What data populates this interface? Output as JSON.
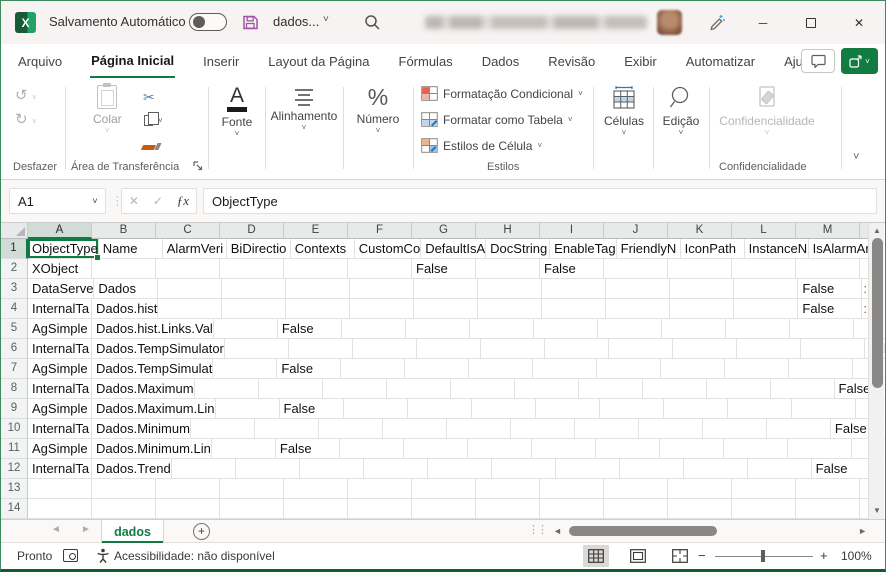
{
  "colors": {
    "excel_green": "#107C41",
    "excel_dark_green": "#185C37",
    "save_purple": "#A155A1",
    "painter_orange": "#C55A11",
    "table_blue": "#BDD7EE",
    "cond_red": "#E8604F"
  },
  "titlebar": {
    "autosave_label": "Salvamento Automático",
    "filename": "dados...",
    "logo_letter": "X"
  },
  "menu": {
    "tabs": [
      {
        "label": "Arquivo"
      },
      {
        "label": "Página Inicial"
      },
      {
        "label": "Inserir"
      },
      {
        "label": "Layout da Página"
      },
      {
        "label": "Fórmulas"
      },
      {
        "label": "Dados"
      },
      {
        "label": "Revisão"
      },
      {
        "label": "Exibir"
      },
      {
        "label": "Automatizar"
      },
      {
        "label": "Ajuda"
      }
    ]
  },
  "ribbon": {
    "undo_group": "Desfazer",
    "clipboard": {
      "paste": "Colar",
      "group": "Área de Transferência"
    },
    "font_group": "Fonte",
    "font_letter": "A",
    "alignment_group": "Alinhamento",
    "number_group": "Número",
    "percent": "%",
    "styles": {
      "items": [
        "Formatação Condicional",
        "Formatar como Tabela",
        "Estilos de Célula"
      ],
      "group": "Estilos"
    },
    "cells_group": "Células",
    "editing_group": "Edição",
    "sensitivity": {
      "button": "Confidencialidade",
      "group": "Confidencialidade"
    }
  },
  "formula_bar": {
    "name_box": "A1",
    "cancel": "✕",
    "confirm": "✓",
    "fx": "ƒx",
    "value": "ObjectType"
  },
  "sheet": {
    "col_headers": [
      "A",
      "B",
      "C",
      "D",
      "E",
      "F",
      "G",
      "H",
      "I",
      "J",
      "K",
      "L",
      "M"
    ],
    "rows": [
      {
        "n": "1",
        "cells": [
          "ObjectType",
          "Name",
          "AlarmVeri",
          "BiDirectio",
          "Contexts",
          "CustomCo",
          "DefaultIsA",
          "DocString",
          "EnableTag",
          "FriendlyN",
          "IconPath",
          "InstanceN",
          "IsAlarmAr",
          "I"
        ]
      },
      {
        "n": "2",
        "cells": [
          "XObject",
          "",
          "",
          "",
          "",
          "",
          "False",
          "",
          "False",
          "",
          "",
          "",
          "",
          ""
        ]
      },
      {
        "n": "3",
        "cells": [
          "DataServe",
          "Dados",
          "",
          "",
          "",
          "",
          "",
          "",
          "",
          "",
          "",
          "",
          "False",
          ":"
        ]
      },
      {
        "n": "4",
        "cells": [
          "InternalTa",
          "Dados.hist",
          "",
          "",
          "",
          "",
          "",
          "",
          "",
          "",
          "",
          "",
          "False",
          ":"
        ]
      },
      {
        "n": "5",
        "cells": [
          "AgSimple",
          "Dados.hist.Links.Val",
          "",
          "False",
          "",
          "",
          "",
          "",
          "",
          "",
          "",
          "",
          "",
          ""
        ]
      },
      {
        "n": "6",
        "cells": [
          "InternalTa",
          "Dados.TempSimulator",
          "",
          "",
          "",
          "",
          "",
          "",
          "",
          "",
          "",
          "",
          "False",
          ":"
        ]
      },
      {
        "n": "7",
        "cells": [
          "AgSimple",
          "Dados.TempSimulat",
          "",
          "False",
          "",
          "",
          "",
          "",
          "",
          "",
          "",
          "",
          "",
          ""
        ]
      },
      {
        "n": "8",
        "cells": [
          "InternalTa",
          "Dados.Maximum",
          "",
          "",
          "",
          "",
          "",
          "",
          "",
          "",
          "",
          "",
          "False",
          ":"
        ]
      },
      {
        "n": "9",
        "cells": [
          "AgSimple",
          "Dados.Maximum.Lin",
          "",
          "False",
          "",
          "",
          "",
          "",
          "",
          "",
          "",
          "",
          "",
          ""
        ]
      },
      {
        "n": "10",
        "cells": [
          "InternalTa",
          "Dados.Minimum",
          "",
          "",
          "",
          "",
          "",
          "",
          "",
          "",
          "",
          "",
          "False",
          ":"
        ]
      },
      {
        "n": "11",
        "cells": [
          "AgSimple",
          "Dados.Minimum.Lin",
          "",
          "False",
          "",
          "",
          "",
          "",
          "",
          "",
          "",
          "",
          "",
          ""
        ]
      },
      {
        "n": "12",
        "cells": [
          "InternalTa",
          "Dados.Trend",
          "",
          "",
          "",
          "",
          "",
          "",
          "",
          "",
          "",
          "",
          "False",
          ":"
        ]
      },
      {
        "n": "13",
        "cells": [
          "",
          "",
          "",
          "",
          "",
          "",
          "",
          "",
          "",
          "",
          "",
          "",
          "",
          ""
        ]
      },
      {
        "n": "14",
        "cells": [
          "",
          "",
          "",
          "",
          "",
          "",
          "",
          "",
          "",
          "",
          "",
          "",
          "",
          ""
        ]
      }
    ]
  },
  "sheetbar": {
    "tab": "dados"
  },
  "status": {
    "mode": "Pronto",
    "accessibility": "Acessibilidade: não disponível",
    "zoom": "100%"
  },
  "icons": {
    "undo": "↺",
    "redo": "↻",
    "cut": "✂",
    "dropdown_chevron": "˅",
    "name_chevron": "˅",
    "filename_chevron": "˅",
    "share_chevron": "˅",
    "collapse_ribbon": "˅",
    "minimize": "─",
    "close": "✕",
    "tab_prev": "◄",
    "tab_next": "►",
    "vscroll_up": "▲",
    "vscroll_down": "▼",
    "hscroll_left": "◄",
    "hscroll_right": "►",
    "add_sheet": "+",
    "drag_dots": "⋮⋮",
    "zoom_out": "−",
    "zoom_in": "+",
    "formula_dots": "⋮"
  }
}
